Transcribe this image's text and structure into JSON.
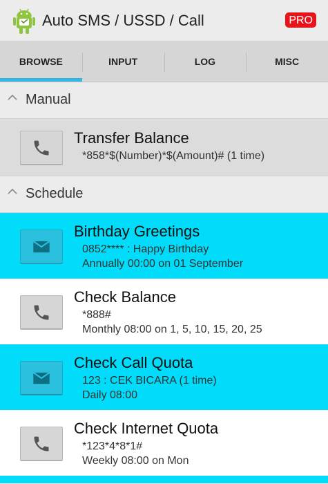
{
  "app": {
    "title": "Auto SMS / USSD / Call",
    "pro_badge": "PRO",
    "accent_color": "#33b5e5",
    "highlight_color": "#00dcfa",
    "icon": "android-robot-icon"
  },
  "tabs": [
    {
      "label": "BROWSE",
      "active": true
    },
    {
      "label": "INPUT",
      "active": false
    },
    {
      "label": "LOG",
      "active": false
    },
    {
      "label": "MISC",
      "active": false
    }
  ],
  "sections": {
    "manual": {
      "label": "Manual",
      "items": [
        {
          "title": "Transfer Balance",
          "line1": "*858*$(Number)*$(Amount)# (1 time)",
          "icon": "phone-icon"
        }
      ]
    },
    "schedule": {
      "label": "Schedule",
      "items": [
        {
          "title": "Birthday Greetings",
          "line1": "0852**** : Happy Birthday",
          "line2": "Annually 00:00 on 01 September",
          "icon": "message-icon",
          "highlighted": true
        },
        {
          "title": "Check Balance",
          "line1": "*888#",
          "line2": "Monthly 08:00 on 1, 5, 10, 15, 20, 25",
          "icon": "phone-icon",
          "highlighted": false
        },
        {
          "title": "Check Call Quota",
          "line1": "123 : CEK BICARA (1 time)",
          "line2": "Daily 08:00",
          "icon": "message-icon",
          "highlighted": true
        },
        {
          "title": "Check Internet Quota",
          "line1": "*123*4*8*1#",
          "line2": "Weekly 08:00 on Mon",
          "icon": "phone-icon",
          "highlighted": false
        }
      ]
    }
  }
}
